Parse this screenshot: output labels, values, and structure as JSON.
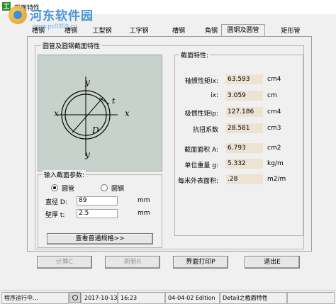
{
  "window": {
    "title": "截面特性",
    "icon_label": "工"
  },
  "watermark": {
    "text": "河东软件园",
    "url": "www.pc0359.cn"
  },
  "tabs": [
    {
      "label": "槽钢",
      "active": false
    },
    {
      "label": "槽钢",
      "active": false
    },
    {
      "label": "工型钢",
      "active": false
    },
    {
      "label": "工字钢",
      "active": false
    },
    {
      "label": "槽钢",
      "active": false
    },
    {
      "label": "角钢",
      "active": false
    },
    {
      "label": "圆钢及圆管",
      "active": true
    },
    {
      "label": "矩形管",
      "active": false
    }
  ],
  "main_group": {
    "title": "圆管及圆钢截面特性"
  },
  "figure": {
    "labels": {
      "y_top": "y",
      "y_bottom": "y",
      "x_left": "x",
      "x_right": "x",
      "t": "t",
      "D": "D"
    }
  },
  "params": {
    "title": "输入截面参数:",
    "radio_pipe": "圆管",
    "radio_bar": "圆钢",
    "selected": "圆管",
    "diameter_label": "直径 D:",
    "diameter_value": "89",
    "diameter_unit": "mm",
    "thickness_label": "壁厚 t:",
    "thickness_value": "2.5",
    "thickness_unit": "mm",
    "spec_button": "查看普通规格>>"
  },
  "props": {
    "title": "截面特性:",
    "rows": [
      {
        "label": "轴惯性矩Ix:",
        "value": "63.593",
        "unit": "cm4"
      },
      {
        "label": "ix:",
        "value": "3.059",
        "unit": "cm"
      },
      {
        "label": "极惯性矩Ip:",
        "value": "127.186",
        "unit": "cm4"
      },
      {
        "label": "抗扭系数",
        "value": "28.581",
        "unit": "cm3"
      },
      {
        "label": "截面面积 A:",
        "value": "6.793",
        "unit": "cm2"
      },
      {
        "label": "单位重量 g:",
        "value": "5.332",
        "unit": "kg/m"
      },
      {
        "label": "每米外表面积:",
        "value": ".28",
        "unit": "m2/m"
      }
    ]
  },
  "buttons": {
    "calc": "计算C",
    "refresh": "刷新R",
    "print": "界面打印P",
    "exit": "退出E"
  },
  "statusbar": {
    "status": "程序运行中...",
    "date": "2017-10-13",
    "time": "16:23",
    "edition": "04-04-02 Edition",
    "detail": "Detail之截面特性"
  }
}
